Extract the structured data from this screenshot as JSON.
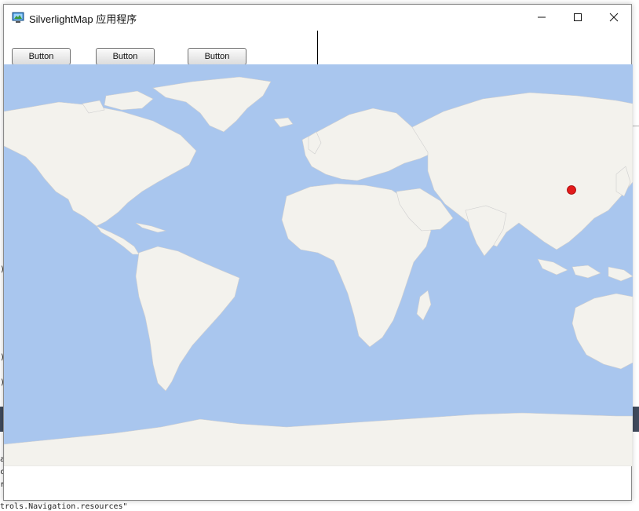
{
  "window": {
    "title": "SilverlightMap 应用程序",
    "icon": "app-window-icon",
    "controls": [
      "minimize-icon",
      "maximize-icon",
      "close-icon"
    ]
  },
  "toolbar": {
    "buttons": [
      {
        "label": "Button"
      },
      {
        "label": "Button"
      },
      {
        "label": "Button"
      }
    ]
  },
  "map": {
    "ocean_color": "#a9c6ee",
    "land_color": "#f3f2ed",
    "marker": {
      "color": "#e21b1b",
      "label": ""
    }
  },
  "background_app": {
    "snippets": [
      ")",
      ")",
      ")",
      "a",
      "c",
      "r",
      "trols.Navigation.resources\""
    ]
  }
}
